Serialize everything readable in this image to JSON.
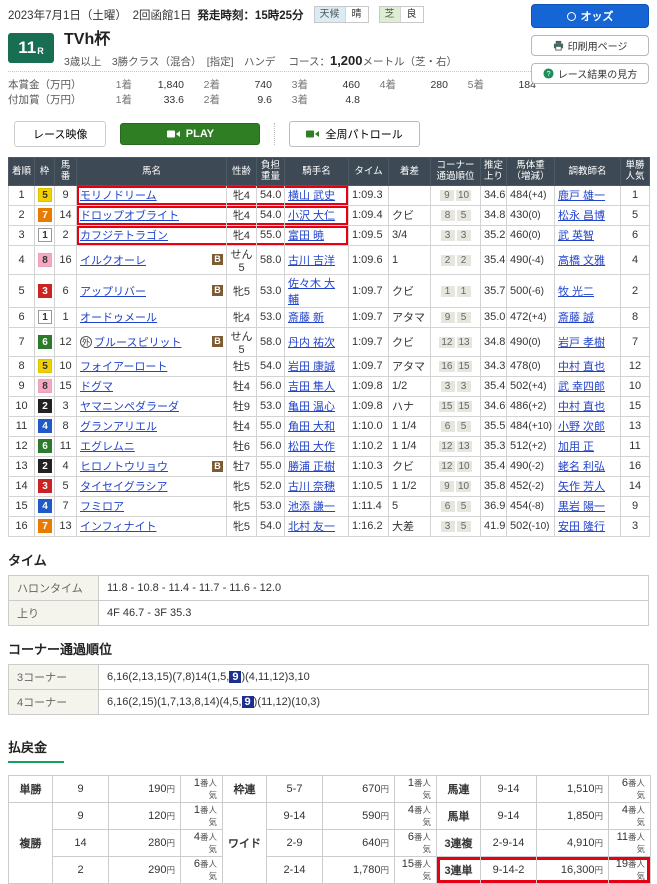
{
  "page": {
    "date_line": "2023年7月1日（土曜）　2回函館1日",
    "start_label": "発走時刻：",
    "start_time": "15時25分",
    "weather_label": "天候",
    "weather_value": "晴",
    "turf_label": "芝",
    "turf_value": "良",
    "race_number": "11",
    "race_number_suffix": "R",
    "race_title": "TVh杯",
    "race_conditions": "3歳以上　3勝クラス（混合）　[指定]　ハンデ",
    "course_label": "コース：",
    "course_distance": "1,200",
    "course_suffix": "メートル（芝・右）",
    "buttons": {
      "odds": "オッズ",
      "print": "印刷用ページ",
      "guide": "レース結果の見方",
      "race_video": "レース映像",
      "play": "PLAY",
      "patrol": "全周パトロール"
    },
    "icons": {
      "odds": "odds-circle-icon",
      "print": "printer-icon",
      "guide": "question-circle-icon",
      "play": "video-camera-icon",
      "patrol": "video-camera-icon"
    }
  },
  "prize": {
    "main_label": "本賞金（万円）",
    "added_label": "付加賞（万円）",
    "main": [
      [
        "1着",
        "1,840"
      ],
      [
        "2着",
        "740"
      ],
      [
        "3着",
        "460"
      ],
      [
        "4着",
        "280"
      ],
      [
        "5着",
        "184"
      ]
    ],
    "added": [
      [
        "1着",
        "33.6"
      ],
      [
        "2着",
        "9.6"
      ],
      [
        "3着",
        "4.8"
      ]
    ]
  },
  "results": {
    "headers": [
      "着順",
      "枠",
      "馬|番",
      "馬名",
      "性齢",
      "負担|重量",
      "騎手名",
      "タイム",
      "着差",
      "コーナー|通過順位",
      "推定|上り",
      "馬体重|（増減）",
      "調教師名",
      "単勝|人気"
    ],
    "blinker_label": "B",
    "foreign_mark": "外",
    "rows": [
      {
        "order": "1",
        "frame": 5,
        "num": "9",
        "name": "モリノドリーム",
        "sexage": "牝4",
        "wt": "54.0",
        "jockey": "横山 武史",
        "time": "1:09.3",
        "margin": "",
        "c": [
          "9",
          "10"
        ],
        "up": "34.6",
        "bw": "484",
        "bwd": "(+4)",
        "trainer": "鹿戸 雄一",
        "fav": "1",
        "hl": true
      },
      {
        "order": "2",
        "frame": 7,
        "num": "14",
        "name": "ドロップオブライト",
        "sexage": "牝4",
        "wt": "54.0",
        "jockey": "小沢 大仁",
        "time": "1:09.4",
        "margin": "クビ",
        "c": [
          "8",
          "5"
        ],
        "up": "34.8",
        "bw": "430",
        "bwd": "(0)",
        "trainer": "松永 昌博",
        "fav": "5",
        "hl": true
      },
      {
        "order": "3",
        "frame": 1,
        "num": "2",
        "name": "カフジテトラゴン",
        "sexage": "牝4",
        "wt": "55.0",
        "jockey": "富田 暁",
        "time": "1:09.5",
        "margin": "3/4",
        "c": [
          "3",
          "3"
        ],
        "up": "35.2",
        "bw": "460",
        "bwd": "(0)",
        "trainer": "武 英智",
        "fav": "6",
        "hl": true
      },
      {
        "order": "4",
        "frame": 8,
        "num": "16",
        "name": "イルクオーレ",
        "b": true,
        "sexage": "せん5",
        "wt": "58.0",
        "jockey": "古川 吉洋",
        "time": "1:09.6",
        "margin": "1",
        "c": [
          "2",
          "2"
        ],
        "up": "35.4",
        "bw": "490",
        "bwd": "(-4)",
        "trainer": "高橋 文雅",
        "fav": "4"
      },
      {
        "order": "5",
        "frame": 3,
        "num": "6",
        "name": "アップリバー",
        "b": true,
        "sexage": "牝5",
        "wt": "53.0",
        "jockey": "佐々木 大輔",
        "time": "1:09.7",
        "margin": "クビ",
        "c": [
          "1",
          "1"
        ],
        "up": "35.7",
        "bw": "500",
        "bwd": "(-6)",
        "trainer": "牧 光二",
        "fav": "2"
      },
      {
        "order": "6",
        "frame": 1,
        "num": "1",
        "name": "オードゥメール",
        "sexage": "牝4",
        "wt": "53.0",
        "jockey": "斎藤 新",
        "time": "1:09.7",
        "margin": "アタマ",
        "c": [
          "9",
          "5"
        ],
        "up": "35.0",
        "bw": "472",
        "bwd": "(+4)",
        "trainer": "斎藤 誠",
        "fav": "8"
      },
      {
        "order": "7",
        "frame": 6,
        "num": "12",
        "name": "ブルースピリット",
        "mark": true,
        "b": true,
        "sexage": "せん5",
        "wt": "58.0",
        "jockey": "丹内 祐次",
        "time": "1:09.7",
        "margin": "クビ",
        "c": [
          "12",
          "13"
        ],
        "up": "34.8",
        "bw": "490",
        "bwd": "(0)",
        "trainer": "岩戸 孝樹",
        "fav": "7"
      },
      {
        "order": "8",
        "frame": 5,
        "num": "10",
        "name": "フォイアーロート",
        "sexage": "牡5",
        "wt": "54.0",
        "jockey": "岩田 康誠",
        "time": "1:09.7",
        "margin": "アタマ",
        "c": [
          "16",
          "15"
        ],
        "up": "34.3",
        "bw": "478",
        "bwd": "(0)",
        "trainer": "中村 直也",
        "fav": "12"
      },
      {
        "order": "9",
        "frame": 8,
        "num": "15",
        "name": "ドグマ",
        "sexage": "牡4",
        "wt": "56.0",
        "jockey": "吉田 隼人",
        "time": "1:09.8",
        "margin": "1/2",
        "c": [
          "3",
          "3"
        ],
        "up": "35.4",
        "bw": "502",
        "bwd": "(+4)",
        "trainer": "武 幸四郎",
        "fav": "10"
      },
      {
        "order": "10",
        "frame": 2,
        "num": "3",
        "name": "ヤマニンペダラーダ",
        "sexage": "牡9",
        "wt": "53.0",
        "jockey": "亀田 温心",
        "time": "1:09.8",
        "margin": "ハナ",
        "c": [
          "15",
          "15"
        ],
        "up": "34.6",
        "bw": "486",
        "bwd": "(+2)",
        "trainer": "中村 直也",
        "fav": "15"
      },
      {
        "order": "11",
        "frame": 4,
        "num": "8",
        "name": "グランアリエル",
        "sexage": "牡4",
        "wt": "55.0",
        "jockey": "角田 大和",
        "time": "1:10.0",
        "margin": "1 1/4",
        "c": [
          "6",
          "5"
        ],
        "up": "35.5",
        "bw": "484",
        "bwd": "(+10)",
        "trainer": "小野 次郎",
        "fav": "13"
      },
      {
        "order": "12",
        "frame": 6,
        "num": "11",
        "name": "エグレムニ",
        "sexage": "牡6",
        "wt": "56.0",
        "jockey": "松田 大作",
        "time": "1:10.2",
        "margin": "1 1/4",
        "c": [
          "12",
          "13"
        ],
        "up": "35.3",
        "bw": "512",
        "bwd": "(+2)",
        "trainer": "加用 正",
        "fav": "11"
      },
      {
        "order": "13",
        "frame": 2,
        "num": "4",
        "name": "ヒロノトウリョウ",
        "b": true,
        "sexage": "牡7",
        "wt": "55.0",
        "jockey": "勝浦 正樹",
        "time": "1:10.3",
        "margin": "クビ",
        "c": [
          "12",
          "10"
        ],
        "up": "35.4",
        "bw": "490",
        "bwd": "(-2)",
        "trainer": "蛯名 利弘",
        "fav": "16"
      },
      {
        "order": "14",
        "frame": 3,
        "num": "5",
        "name": "タイセイグラシア",
        "sexage": "牝5",
        "wt": "52.0",
        "jockey": "古川 奈穂",
        "time": "1:10.5",
        "margin": "1 1/2",
        "c": [
          "9",
          "10"
        ],
        "up": "35.8",
        "bw": "452",
        "bwd": "(-2)",
        "trainer": "矢作 芳人",
        "fav": "14"
      },
      {
        "order": "15",
        "frame": 4,
        "num": "7",
        "name": "フミロア",
        "sexage": "牝5",
        "wt": "53.0",
        "jockey": "池添 謙一",
        "time": "1:11.4",
        "margin": "5",
        "c": [
          "6",
          "5"
        ],
        "up": "36.9",
        "bw": "454",
        "bwd": "(-8)",
        "trainer": "黒岩 陽一",
        "fav": "9"
      },
      {
        "order": "16",
        "frame": 7,
        "num": "13",
        "name": "インフィナイト",
        "sexage": "牝5",
        "wt": "54.0",
        "jockey": "北村 友一",
        "time": "1:16.2",
        "margin": "大差",
        "c": [
          "3",
          "5"
        ],
        "up": "41.9",
        "bw": "502",
        "bwd": "(-10)",
        "trainer": "安田 隆行",
        "fav": "3"
      }
    ]
  },
  "time_section": {
    "heading": "タイム",
    "rows": [
      {
        "label": "ハロンタイム",
        "value": "11.8 - 10.8 - 11.4 - 11.7 - 11.6 - 12.0"
      },
      {
        "label": "上り",
        "value": "4F 46.7 - 3F 35.3"
      }
    ]
  },
  "corner_section": {
    "heading": "コーナー通過順位",
    "rows": [
      {
        "label": "3コーナー",
        "pre": "6,16(2,13,15)(7,8)14(1,5,",
        "mark": "9",
        "post": ")(4,11,12)3,10"
      },
      {
        "label": "4コーナー",
        "pre": "6,16(2,15)(1,7,13,8,14)(4,5,",
        "mark": "9",
        "post": ")(11,12)(10,3)"
      }
    ]
  },
  "payout": {
    "heading": "払戻金",
    "yen": "円",
    "fav_suffix": "番人気",
    "rows": [
      [
        {
          "type": "単勝",
          "sel": "9",
          "pay": "190",
          "fav": "1"
        },
        {
          "type": "枠連",
          "sel": "5-7",
          "pay": "670",
          "fav": "1"
        },
        {
          "type": "馬連",
          "sel": "9-14",
          "pay": "1,510",
          "fav": "6"
        }
      ],
      [
        {
          "type": "複勝",
          "span": 3,
          "sel": "9",
          "pay": "120",
          "fav": "1"
        },
        {
          "type": "ワイド",
          "span": 3,
          "sel": "9-14",
          "pay": "590",
          "fav": "4"
        },
        {
          "type": "馬単",
          "sel": "9-14",
          "pay": "1,850",
          "fav": "4"
        }
      ],
      [
        {
          "sel": "14",
          "pay": "280",
          "fav": "4",
          "dash": true
        },
        {
          "sel": "2-9",
          "pay": "640",
          "fav": "6",
          "dash": true
        },
        {
          "type": "3連複",
          "sel": "2-9-14",
          "pay": "4,910",
          "fav": "11"
        }
      ],
      [
        {
          "sel": "2",
          "pay": "290",
          "fav": "6",
          "dash": true
        },
        {
          "sel": "2-14",
          "pay": "1,780",
          "fav": "15",
          "dash": true
        },
        {
          "type": "3連単",
          "sel": "9-14-2",
          "pay": "16,300",
          "fav": "19",
          "hl": true
        }
      ]
    ]
  },
  "colors": {
    "highlight_red": "#e60012",
    "corner_mark_navy": "#1c2f91",
    "table_header": "#3d4a55",
    "link_blue": "#2244cc",
    "accent_green": "#176e52",
    "play_green": "#2f7e23",
    "button_blue": "#1566d4",
    "frames": {
      "1": {
        "bg": "#ffffff",
        "fg": "#333333",
        "border": "#999999"
      },
      "2": {
        "bg": "#222222",
        "fg": "#ffffff",
        "border": "#222222"
      },
      "3": {
        "bg": "#cc2222",
        "fg": "#ffffff",
        "border": "#cc2222"
      },
      "4": {
        "bg": "#1e5bc6",
        "fg": "#ffffff",
        "border": "#1e5bc6"
      },
      "5": {
        "bg": "#f0d000",
        "fg": "#333333",
        "border": "#e0c300"
      },
      "6": {
        "bg": "#2c7a2c",
        "fg": "#ffffff",
        "border": "#2c7a2c"
      },
      "7": {
        "bg": "#e87c00",
        "fg": "#ffffff",
        "border": "#e87c00"
      },
      "8": {
        "bg": "#f5a8bf",
        "fg": "#333333",
        "border": "#eda0b8"
      }
    }
  }
}
